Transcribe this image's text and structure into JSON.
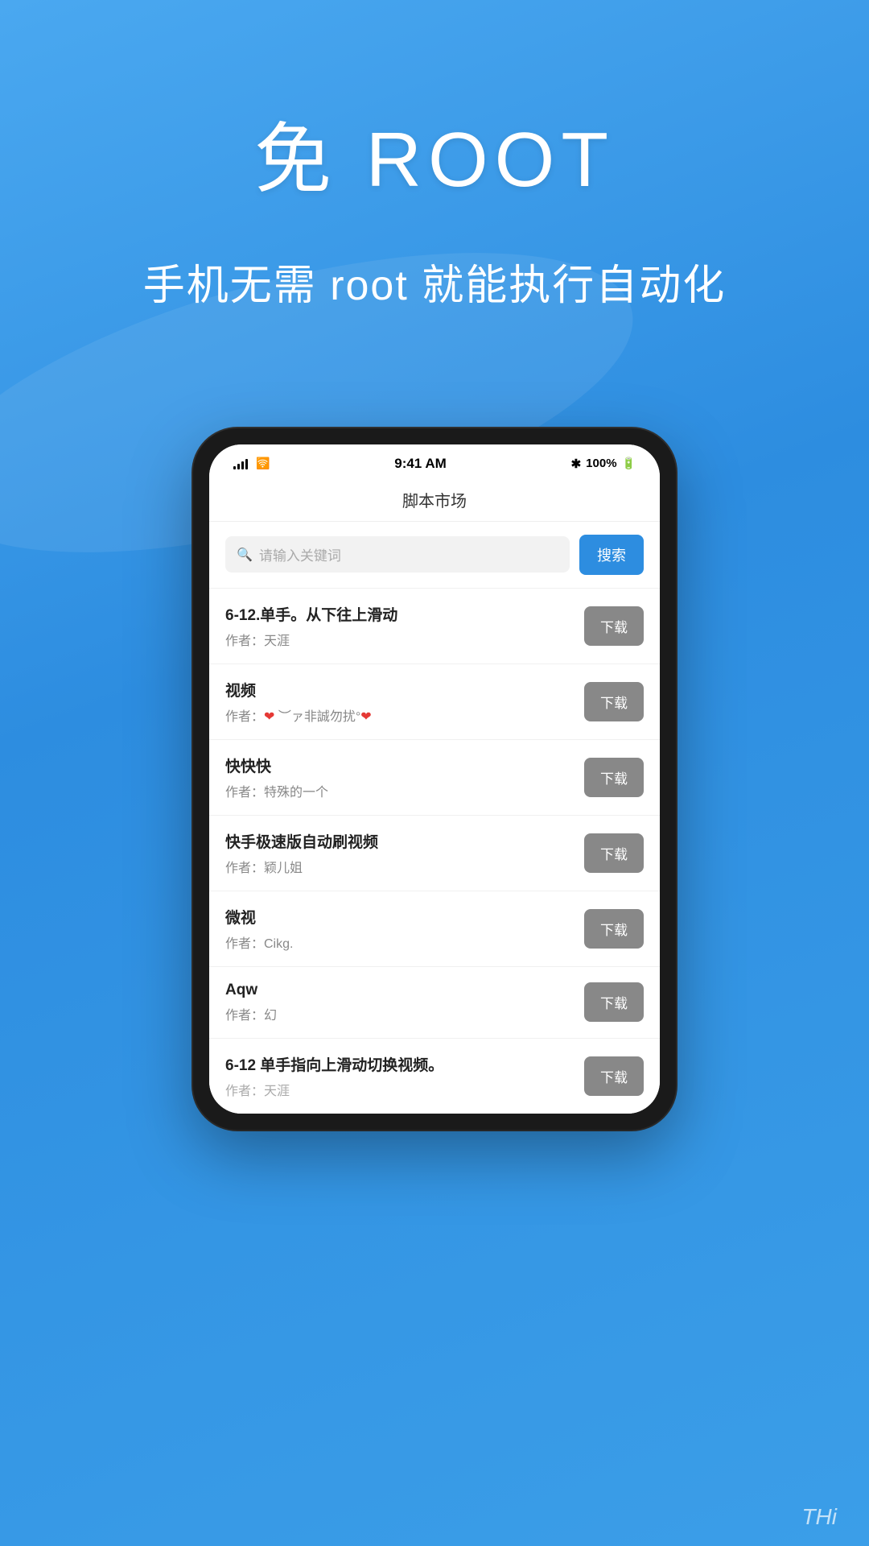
{
  "header": {
    "main_title": "免 ROOT",
    "subtitle": "手机无需 root 就能执行自动化"
  },
  "status_bar": {
    "time": "9:41 AM",
    "battery": "100%",
    "bluetooth": "✱"
  },
  "nav": {
    "title": "脚本市场"
  },
  "search": {
    "placeholder": "请输入关键词",
    "button_label": "搜索"
  },
  "scripts": [
    {
      "title": "6-12.单手。从下往上滑动",
      "author": "作者：天涯",
      "download_label": "下载"
    },
    {
      "title": "视频",
      "author_prefix": "作者：",
      "author_name": "❤ ︶ァ非誠勿扰°❤",
      "download_label": "下载"
    },
    {
      "title": "快快快",
      "author": "作者：特殊的一个",
      "download_label": "下载"
    },
    {
      "title": "快手极速版自动刷视频",
      "author": "作者：颖儿姐",
      "download_label": "下载"
    },
    {
      "title": "微视",
      "author": "作者：Cikg.",
      "download_label": "下载"
    },
    {
      "title": "Aqw",
      "author": "作者：幻",
      "download_label": "下载"
    },
    {
      "title": "6-12 单手指向上滑动切换视频。",
      "author": "作者：天涯",
      "download_label": "下载"
    }
  ],
  "watermark": {
    "text": "THi"
  }
}
